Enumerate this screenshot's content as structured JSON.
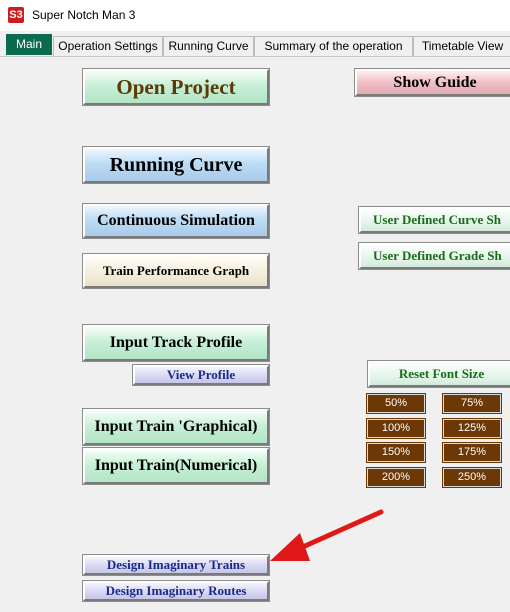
{
  "window": {
    "title": "Super Notch Man 3",
    "icon_text": "S3"
  },
  "tabs": [
    {
      "label": "Main"
    },
    {
      "label": "Operation Settings"
    },
    {
      "label": "Running Curve"
    },
    {
      "label": "Summary of the operation"
    },
    {
      "label": "Timetable View"
    }
  ],
  "buttons": {
    "open_project": "Open Project",
    "show_guide": "Show Guide",
    "running_curve": "Running Curve",
    "continuous_simulation": "Continuous Simulation",
    "user_defined_curve": "User Defined Curve Sh",
    "train_performance_graph": "Train Performance Graph",
    "user_defined_grade": "User Defined Grade Sh",
    "input_track_profile": "Input Track Profile",
    "view_profile": "View Profile",
    "reset_font_size": "Reset Font Size",
    "input_train_graphical": "Input Train 'Graphical)",
    "input_train_numerical": "Input Train(Numerical)",
    "design_imaginary_trains": "Design Imaginary Trains",
    "design_imaginary_routes": "Design Imaginary Routes"
  },
  "font_sizes": [
    "50%",
    "75%",
    "100%",
    "125%",
    "150%",
    "175%",
    "200%",
    "250%"
  ],
  "colors": {
    "active_tab": "#0a6b4f",
    "font_button": "#6b3806",
    "arrow": "#e01818"
  }
}
